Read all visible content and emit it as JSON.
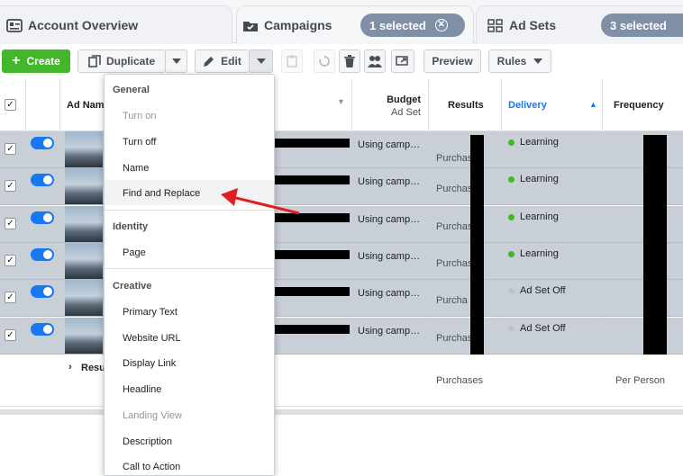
{
  "tabs": {
    "account_overview": "Account Overview",
    "campaigns": "Campaigns",
    "campaigns_selected": "1 selected",
    "ad_sets": "Ad Sets",
    "ad_sets_selected": "3 selected"
  },
  "toolbar": {
    "create": "Create",
    "duplicate": "Duplicate",
    "edit": "Edit",
    "preview": "Preview",
    "rules": "Rules"
  },
  "table": {
    "headers": {
      "ad_name": "Ad Nam",
      "budget": "Budget",
      "budget_sub": "Ad Set",
      "results": "Results",
      "delivery": "Delivery",
      "frequency": "Frequency"
    },
    "rows": [
      {
        "budget": "Using camp…",
        "results": "Purchas",
        "delivery": "Learning",
        "delivery_color": "#42b72a"
      },
      {
        "budget": "Using camp…",
        "results": "Purchas",
        "delivery": "Learning",
        "delivery_color": "#42b72a"
      },
      {
        "budget": "Using camp…",
        "results": "Purchas",
        "delivery": "Learning",
        "delivery_color": "#42b72a"
      },
      {
        "budget": "Using camp…",
        "results": "Purchas",
        "delivery": "Learning",
        "delivery_color": "#42b72a"
      },
      {
        "budget": "Using camp…",
        "results": "Purcha",
        "delivery": "Ad Set Off",
        "delivery_color": "#bec3c9"
      },
      {
        "budget": "Using camp…",
        "results": "Purchas",
        "delivery": "Ad Set Off",
        "delivery_color": "#bec3c9"
      }
    ],
    "summary": {
      "label": "Resu",
      "results": "Purchases",
      "frequency": "Per Person"
    }
  },
  "menu": {
    "general_header": "General",
    "turn_on": "Turn on",
    "turn_off": "Turn off",
    "name": "Name",
    "find_replace": "Find and Replace",
    "identity_header": "Identity",
    "page": "Page",
    "creative_header": "Creative",
    "primary_text": "Primary Text",
    "website_url": "Website URL",
    "display_link": "Display Link",
    "headline": "Headline",
    "landing_view": "Landing View",
    "description": "Description",
    "call_to_action": "Call to Action"
  },
  "colors": {
    "accent": "#1877f2",
    "create_green": "#42b72a",
    "pill": "#7f8fa6",
    "arrow_red": "#e02020"
  }
}
